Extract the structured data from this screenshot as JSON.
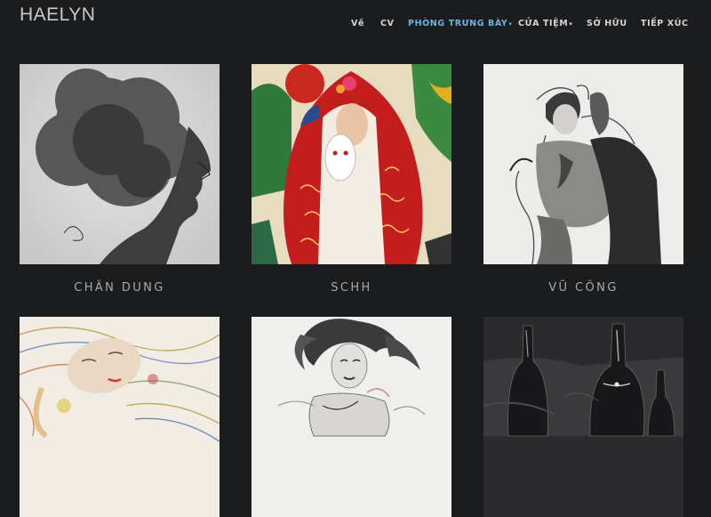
{
  "site": {
    "logo": "HAELYN"
  },
  "nav": {
    "items": [
      {
        "label": "Về"
      },
      {
        "label": "CV"
      },
      {
        "label": "Phòng trưng bày"
      },
      {
        "label": "Cửa tiệm"
      },
      {
        "label": "Sở hữu"
      },
      {
        "label": "Tiếp xúc"
      }
    ]
  },
  "gallery": {
    "tiles": [
      {
        "title": "Chân dung"
      },
      {
        "title": "SCHH"
      },
      {
        "title": "Vũ công"
      },
      {
        "title": ""
      },
      {
        "title": ""
      },
      {
        "title": ""
      }
    ]
  },
  "colors": {
    "background": "#1b1c1e",
    "accent": "#6cb6e0"
  }
}
